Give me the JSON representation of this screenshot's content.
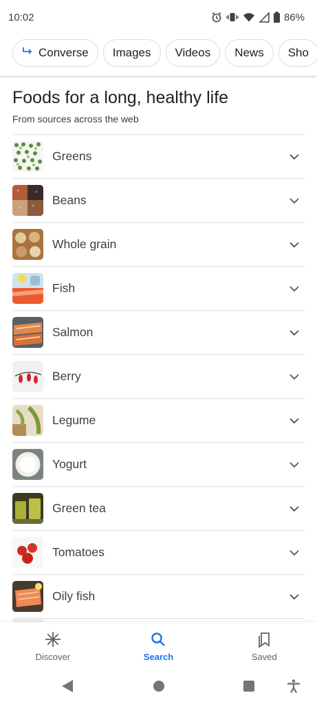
{
  "status": {
    "time": "10:02",
    "battery": "86%"
  },
  "chips": [
    {
      "label": "Converse",
      "icon": "arrow-return-icon"
    },
    {
      "label": "Images"
    },
    {
      "label": "Videos"
    },
    {
      "label": "News"
    },
    {
      "label": "Sho"
    }
  ],
  "header": {
    "title": "Foods for a long, healthy life",
    "subtitle": "From sources across the web"
  },
  "foods": [
    {
      "label": "Greens"
    },
    {
      "label": "Beans"
    },
    {
      "label": "Whole grain"
    },
    {
      "label": "Fish"
    },
    {
      "label": "Salmon"
    },
    {
      "label": "Berry"
    },
    {
      "label": "Legume"
    },
    {
      "label": "Yogurt"
    },
    {
      "label": "Green tea"
    },
    {
      "label": "Tomatoes"
    },
    {
      "label": "Oily fish"
    }
  ],
  "nav": [
    {
      "label": "Discover",
      "icon": "asterisk-icon"
    },
    {
      "label": "Search",
      "icon": "search-icon",
      "active": true
    },
    {
      "label": "Saved",
      "icon": "bookmarks-icon"
    }
  ],
  "colors": {
    "accent": "#1a73e8",
    "divider": "#e0e0e0",
    "text": "#3c4043"
  }
}
